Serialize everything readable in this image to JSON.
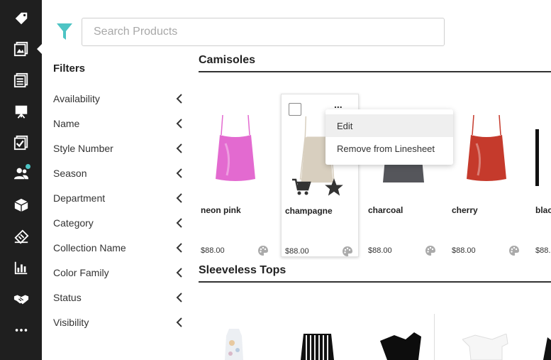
{
  "rail": {
    "items": [
      {
        "icon": "tag-icon"
      },
      {
        "icon": "linesheet-icon",
        "active": true
      },
      {
        "icon": "catalog-icon"
      },
      {
        "icon": "presentation-icon"
      },
      {
        "icon": "checklist-icon"
      },
      {
        "icon": "users-icon",
        "has_dot": true
      },
      {
        "icon": "box-icon"
      },
      {
        "icon": "orders-icon"
      },
      {
        "icon": "analytics-icon"
      },
      {
        "icon": "handshake-icon"
      },
      {
        "icon": "more-icon"
      }
    ]
  },
  "search": {
    "placeholder": "Search Products"
  },
  "filters": {
    "title": "Filters",
    "items": [
      "Availability",
      "Name",
      "Style Number",
      "Season",
      "Department",
      "Category",
      "Collection Name",
      "Color Family",
      "Status",
      "Visibility"
    ]
  },
  "sections": [
    {
      "title": "Camisoles",
      "products": [
        {
          "name": "neon pink",
          "price": "$88.00",
          "color": "#e36ad0"
        },
        {
          "name": "champagne",
          "price": "$88.00",
          "color": "#d8cfbf"
        },
        {
          "name": "charcoal",
          "price": "$88.00",
          "color": "#55565b"
        },
        {
          "name": "cherry",
          "price": "$88.00",
          "color": "#c53a2c"
        },
        {
          "name": "blac",
          "price": "$88.",
          "color": "#111111"
        }
      ]
    },
    {
      "title": "Sleeveless Tops"
    }
  ],
  "context_menu": {
    "items": [
      "Edit",
      "Remove from Linesheet"
    ]
  },
  "more_label": "...",
  "colors": {
    "accent": "#4dc4c4",
    "rail_bg": "#1f1f1f"
  }
}
